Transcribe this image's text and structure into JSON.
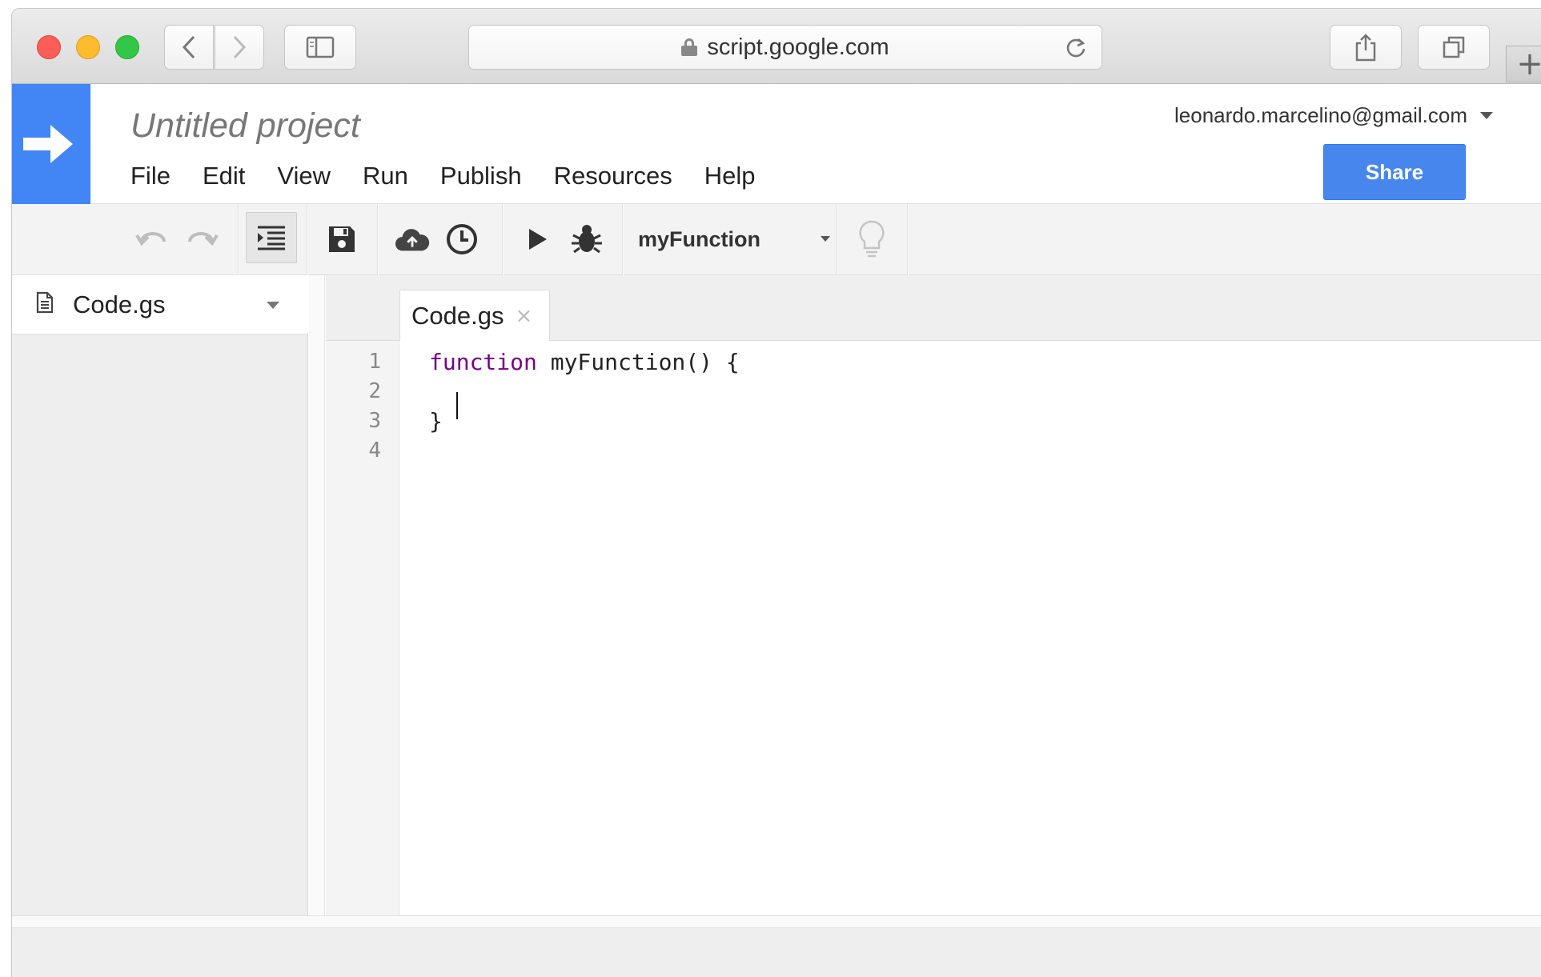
{
  "browser": {
    "url": "script.google.com"
  },
  "app": {
    "project_title": "Untitled project",
    "menu": [
      "File",
      "Edit",
      "View",
      "Run",
      "Publish",
      "Resources",
      "Help"
    ],
    "account_email": "leonardo.marcelino@gmail.com",
    "share_label": "Share",
    "brand_color": "#4285f4"
  },
  "toolbar": {
    "function_select": "myFunction",
    "icons": [
      "undo-icon",
      "redo-icon",
      "indent-icon",
      "save-icon",
      "cloud-icon",
      "clock-icon",
      "run-icon",
      "debug-icon",
      "lightbulb-icon"
    ]
  },
  "files": [
    {
      "name": "Code.gs"
    }
  ],
  "editor": {
    "active_tab": "Code.gs",
    "line_numbers": [
      "1",
      "2",
      "3",
      "4"
    ],
    "code": {
      "line1_keyword": "function",
      "line1_rest": " myFunction() {",
      "line2": "",
      "line3": "}",
      "line4": ""
    },
    "keyword_color": "#770088"
  }
}
